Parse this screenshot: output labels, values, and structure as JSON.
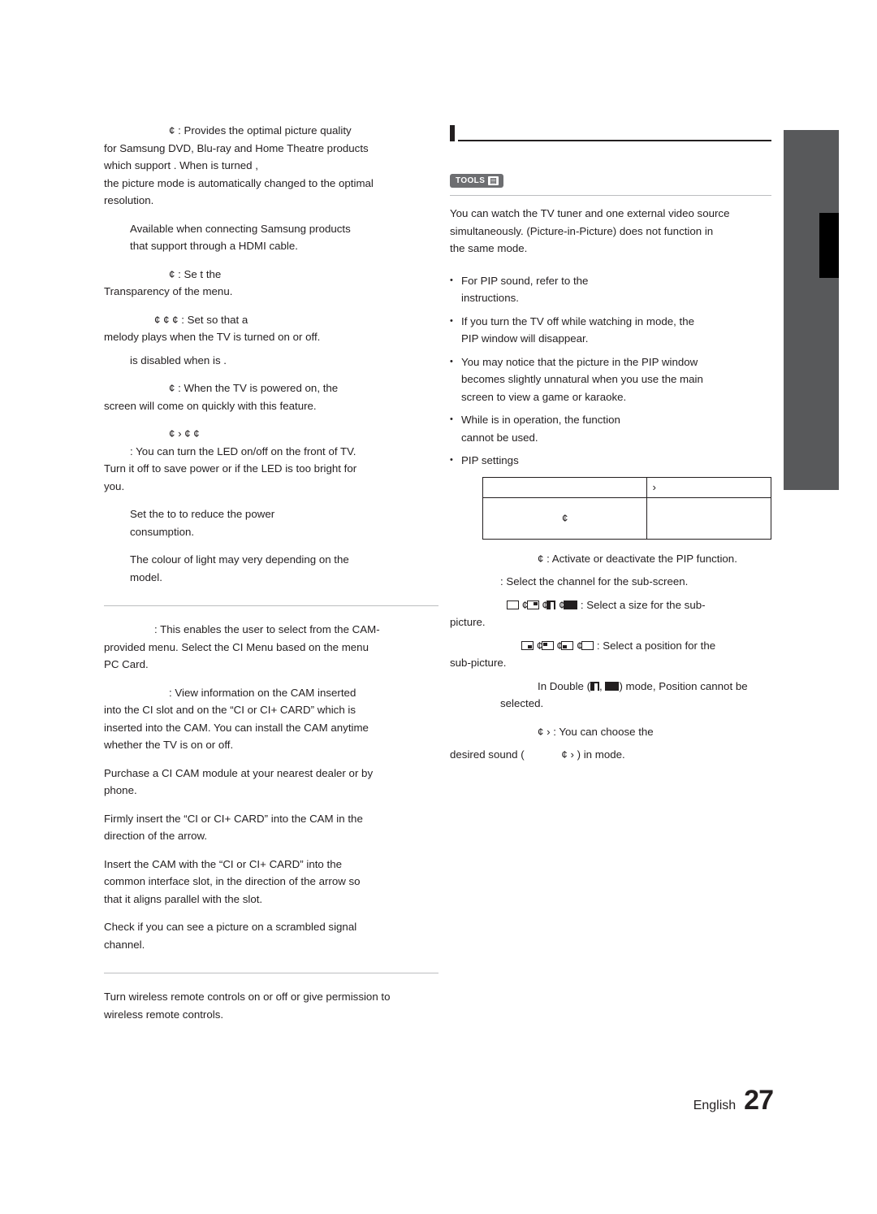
{
  "page": {
    "footer_language": "English",
    "footer_page_number": "27"
  },
  "left_column": {
    "blocks": [
      {
        "id": "anynet_intro",
        "text": "¢ : Provides the optimal picture quality"
      },
      {
        "id": "anynet_intro2",
        "text": "for Samsung DVD, Blu-ray and Home Theatre products"
      },
      {
        "id": "anynet_intro3",
        "text": "which support                   . When                      is turned        ,"
      },
      {
        "id": "anynet_intro4",
        "text": "the picture mode is automatically changed to the optimal"
      },
      {
        "id": "anynet_intro5",
        "text": "resolution."
      },
      {
        "id": "available_note1",
        "text": "Available when connecting Samsung products"
      },
      {
        "id": "available_note2",
        "text": "that support                     through a HDMI cable."
      },
      {
        "id": "transparency1",
        "text": "¢       : Se t the"
      },
      {
        "id": "transparency2",
        "text": "Transparency of the menu."
      },
      {
        "id": "melody1",
        "text": "¢      ¢            ¢       : Set so that a"
      },
      {
        "id": "melody2",
        "text": "melody plays when the TV is turned on or off."
      },
      {
        "id": "melody_note",
        "text": "is disabled when                        is       ."
      },
      {
        "id": "standby1",
        "text": "¢      : When the TV is powered on, the"
      },
      {
        "id": "standby2",
        "text": "screen will come on quickly with this feature."
      },
      {
        "id": "light_effect1",
        "text": "¢              ›     ¢                 ¢"
      },
      {
        "id": "light_effect2",
        "text": ": You can turn the LED on/off on the front of TV."
      },
      {
        "id": "light_effect3",
        "text": "Turn it off to save power or if the LED is too bright for"
      },
      {
        "id": "light_effect4",
        "text": "you."
      },
      {
        "id": "set_power1",
        "text": "Set the                       to       to reduce the power"
      },
      {
        "id": "set_power2",
        "text": "consumption."
      },
      {
        "id": "colour_note1",
        "text": "The colour of light may very depending on the"
      },
      {
        "id": "colour_note2",
        "text": "model."
      }
    ],
    "ci_section": [
      {
        "id": "ci_menu1",
        "text": ": This enables the user to select from the CAM-"
      },
      {
        "id": "ci_menu2",
        "text": "provided menu. Select the CI Menu based on the menu"
      },
      {
        "id": "ci_menu3",
        "text": "PC Card."
      },
      {
        "id": "cam_info1",
        "text": ": View information on the CAM inserted"
      },
      {
        "id": "cam_info2",
        "text": "into the CI slot and on the “CI or CI+ CARD” which is"
      },
      {
        "id": "cam_info3",
        "text": "inserted into the CAM. You can install the CAM anytime"
      },
      {
        "id": "cam_info4",
        "text": "whether the TV is on or off."
      },
      {
        "id": "purchase1",
        "text": "Purchase a CI CAM module at your nearest dealer or by"
      },
      {
        "id": "purchase2",
        "text": "phone."
      },
      {
        "id": "insert1",
        "text": "Firmly insert the “CI or CI+ CARD” into the CAM in the"
      },
      {
        "id": "insert2",
        "text": "direction of the arrow."
      },
      {
        "id": "insert3",
        "text": "Insert the CAM with the “CI or CI+ CARD” into the"
      },
      {
        "id": "insert4",
        "text": "common interface slot, in the direction of the arrow so"
      },
      {
        "id": "insert5",
        "text": "that it aligns parallel with the slot."
      },
      {
        "id": "check1",
        "text": "Check if you can see a picture on a scrambled signal"
      },
      {
        "id": "check2",
        "text": "channel."
      }
    ],
    "wireless_section": [
      {
        "id": "wireless1",
        "text": "Turn wireless remote controls on or off or give permission to"
      },
      {
        "id": "wireless2",
        "text": "wireless remote controls."
      }
    ]
  },
  "right_column": {
    "tools_badge_label": "TOOLS",
    "tools_badge_glyph": "▤",
    "intro": [
      {
        "id": "intro1",
        "text": "You can watch the TV tuner and one external video source"
      },
      {
        "id": "intro2",
        "text": "simultaneously.        (Picture-in-Picture) does not function in"
      },
      {
        "id": "intro3",
        "text": "the same mode."
      }
    ],
    "bullets": [
      {
        "id": "b1",
        "lines": [
          "For PIP sound, refer to the",
          "instructions."
        ]
      },
      {
        "id": "b2",
        "lines": [
          "If you turn the TV off while watching in          mode, the",
          "PIP window will disappear."
        ]
      },
      {
        "id": "b3",
        "lines": [
          "You may notice that the picture in the PIP window",
          "becomes slightly unnatural when you use the main",
          "screen to view a game or karaoke."
        ]
      },
      {
        "id": "b4",
        "lines": [
          "While                    is in operation, the         function",
          "cannot be used."
        ]
      },
      {
        "id": "b5",
        "lines": [
          "PIP settings"
        ]
      }
    ],
    "pip_table": {
      "rows": [
        {
          "cells": [
            "",
            "›"
          ]
        },
        {
          "cells": [
            "¢",
            ""
          ]
        }
      ]
    },
    "after_table": [
      {
        "id": "a1",
        "text": "¢       : Activate or deactivate the PIP function."
      },
      {
        "id": "a2",
        "text": ": Select the channel for the sub-screen."
      },
      {
        "id": "a3",
        "text": ": Select a size for the sub-"
      },
      {
        "id": "a4",
        "text": "picture."
      },
      {
        "id": "a5",
        "text": ": Select a position for the"
      },
      {
        "id": "a6",
        "text": "sub-picture."
      },
      {
        "id": "a7_pre",
        "text": "In Double ("
      },
      {
        "id": "a7_mid",
        "text": ", "
      },
      {
        "id": "a7_post",
        "text": ") mode, Position cannot be"
      },
      {
        "id": "a8",
        "text": "selected."
      },
      {
        "id": "a9",
        "text": "¢      › : You can choose the"
      },
      {
        "id": "a10_pre",
        "text": "desired sound ("
      },
      {
        "id": "a10_mid",
        "text": "¢      › ) in       mode."
      }
    ]
  }
}
